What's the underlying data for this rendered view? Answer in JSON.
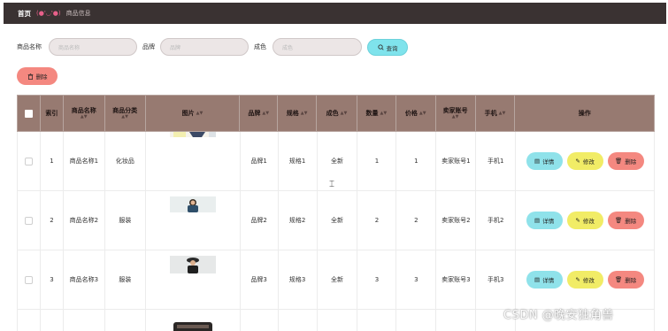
{
  "breadcrumb": {
    "home": "首页",
    "emoji": "(●'◡'●)",
    "page": "商品信息"
  },
  "search": {
    "name_label": "商品名称",
    "name_placeholder": "商品名称",
    "brand_label": "品牌",
    "brand_placeholder": "品牌",
    "condition_label": "成色",
    "condition_placeholder": "成色",
    "query_label": "查询"
  },
  "toolbar": {
    "delete_label": "删除"
  },
  "table": {
    "headers": [
      "索引",
      "商品名称",
      "商品分类",
      "图片",
      "品牌",
      "规格",
      "成色",
      "数量",
      "价格",
      "卖家账号",
      "手机",
      "操作"
    ],
    "rows": [
      {
        "index": "1",
        "name": "商品名称1",
        "category": "化妆品",
        "brand": "品牌1",
        "spec": "规格1",
        "condition": "全新",
        "qty": "1",
        "price": "1",
        "seller": "卖家账号1",
        "phone": "手机1"
      },
      {
        "index": "2",
        "name": "商品名称2",
        "category": "服装",
        "brand": "品牌2",
        "spec": "规格2",
        "condition": "全新",
        "qty": "2",
        "price": "2",
        "seller": "卖家账号2",
        "phone": "手机2"
      },
      {
        "index": "3",
        "name": "商品名称3",
        "category": "服装",
        "brand": "品牌3",
        "spec": "规格3",
        "condition": "全新",
        "qty": "3",
        "price": "3",
        "seller": "卖家账号3",
        "phone": "手机3"
      }
    ],
    "actions": {
      "detail": "详情",
      "edit": "修改",
      "delete": "删除"
    }
  },
  "watermark": "CSDN @晚安独角兽",
  "colors": {
    "header_bg": "#977a71",
    "topbar_bg": "#3a3232",
    "detail_btn": "#8fe2ea",
    "edit_btn": "#f1ec66",
    "delete_btn": "#f48880"
  }
}
